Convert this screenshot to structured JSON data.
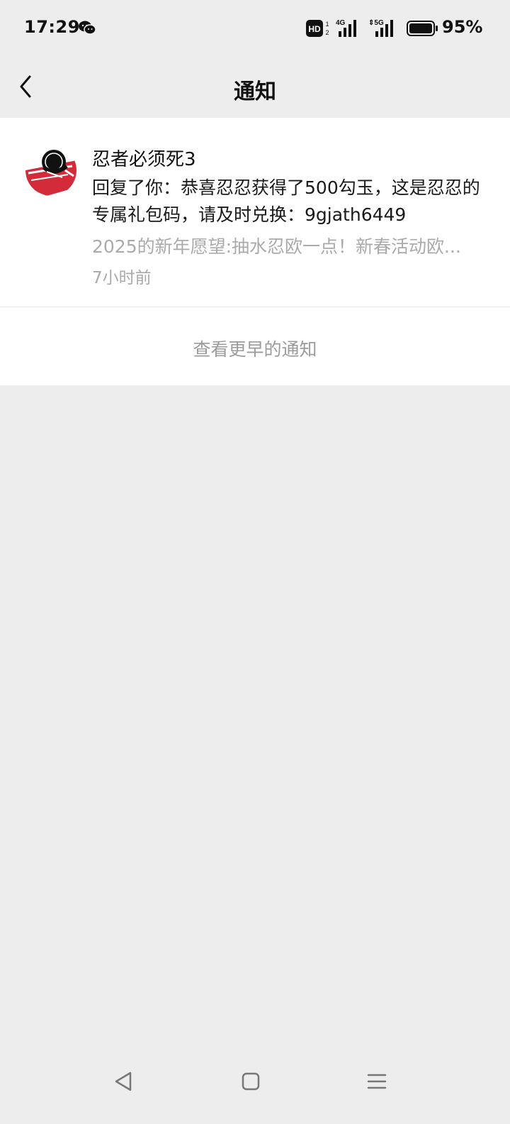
{
  "status_bar": {
    "time": "17:29",
    "battery": "95%",
    "icons": [
      "wechat-icon",
      "hd-icon",
      "signal-4g-icon",
      "signal-5g-icon",
      "battery-icon"
    ]
  },
  "header": {
    "title": "通知",
    "back_icon": "chevron-left-icon"
  },
  "notification": {
    "sender": "忍者必须死3",
    "body": "回复了你：恭喜忍忍获得了500勾玉，这是忍忍的专属礼包码，请及时兑换：9gjath6449",
    "quote": "2025的新年愿望:抽水忍欧一点！新春活动欧...",
    "time": "7小时前"
  },
  "earlier_link": "查看更早的通知",
  "nav": {
    "icons": [
      "nav-back-icon",
      "nav-home-icon",
      "nav-menu-icon"
    ]
  },
  "colors": {
    "background": "#ededed",
    "card": "#ffffff",
    "muted_text": "#aaaaaa",
    "avatar_red": "#d32b3a"
  }
}
